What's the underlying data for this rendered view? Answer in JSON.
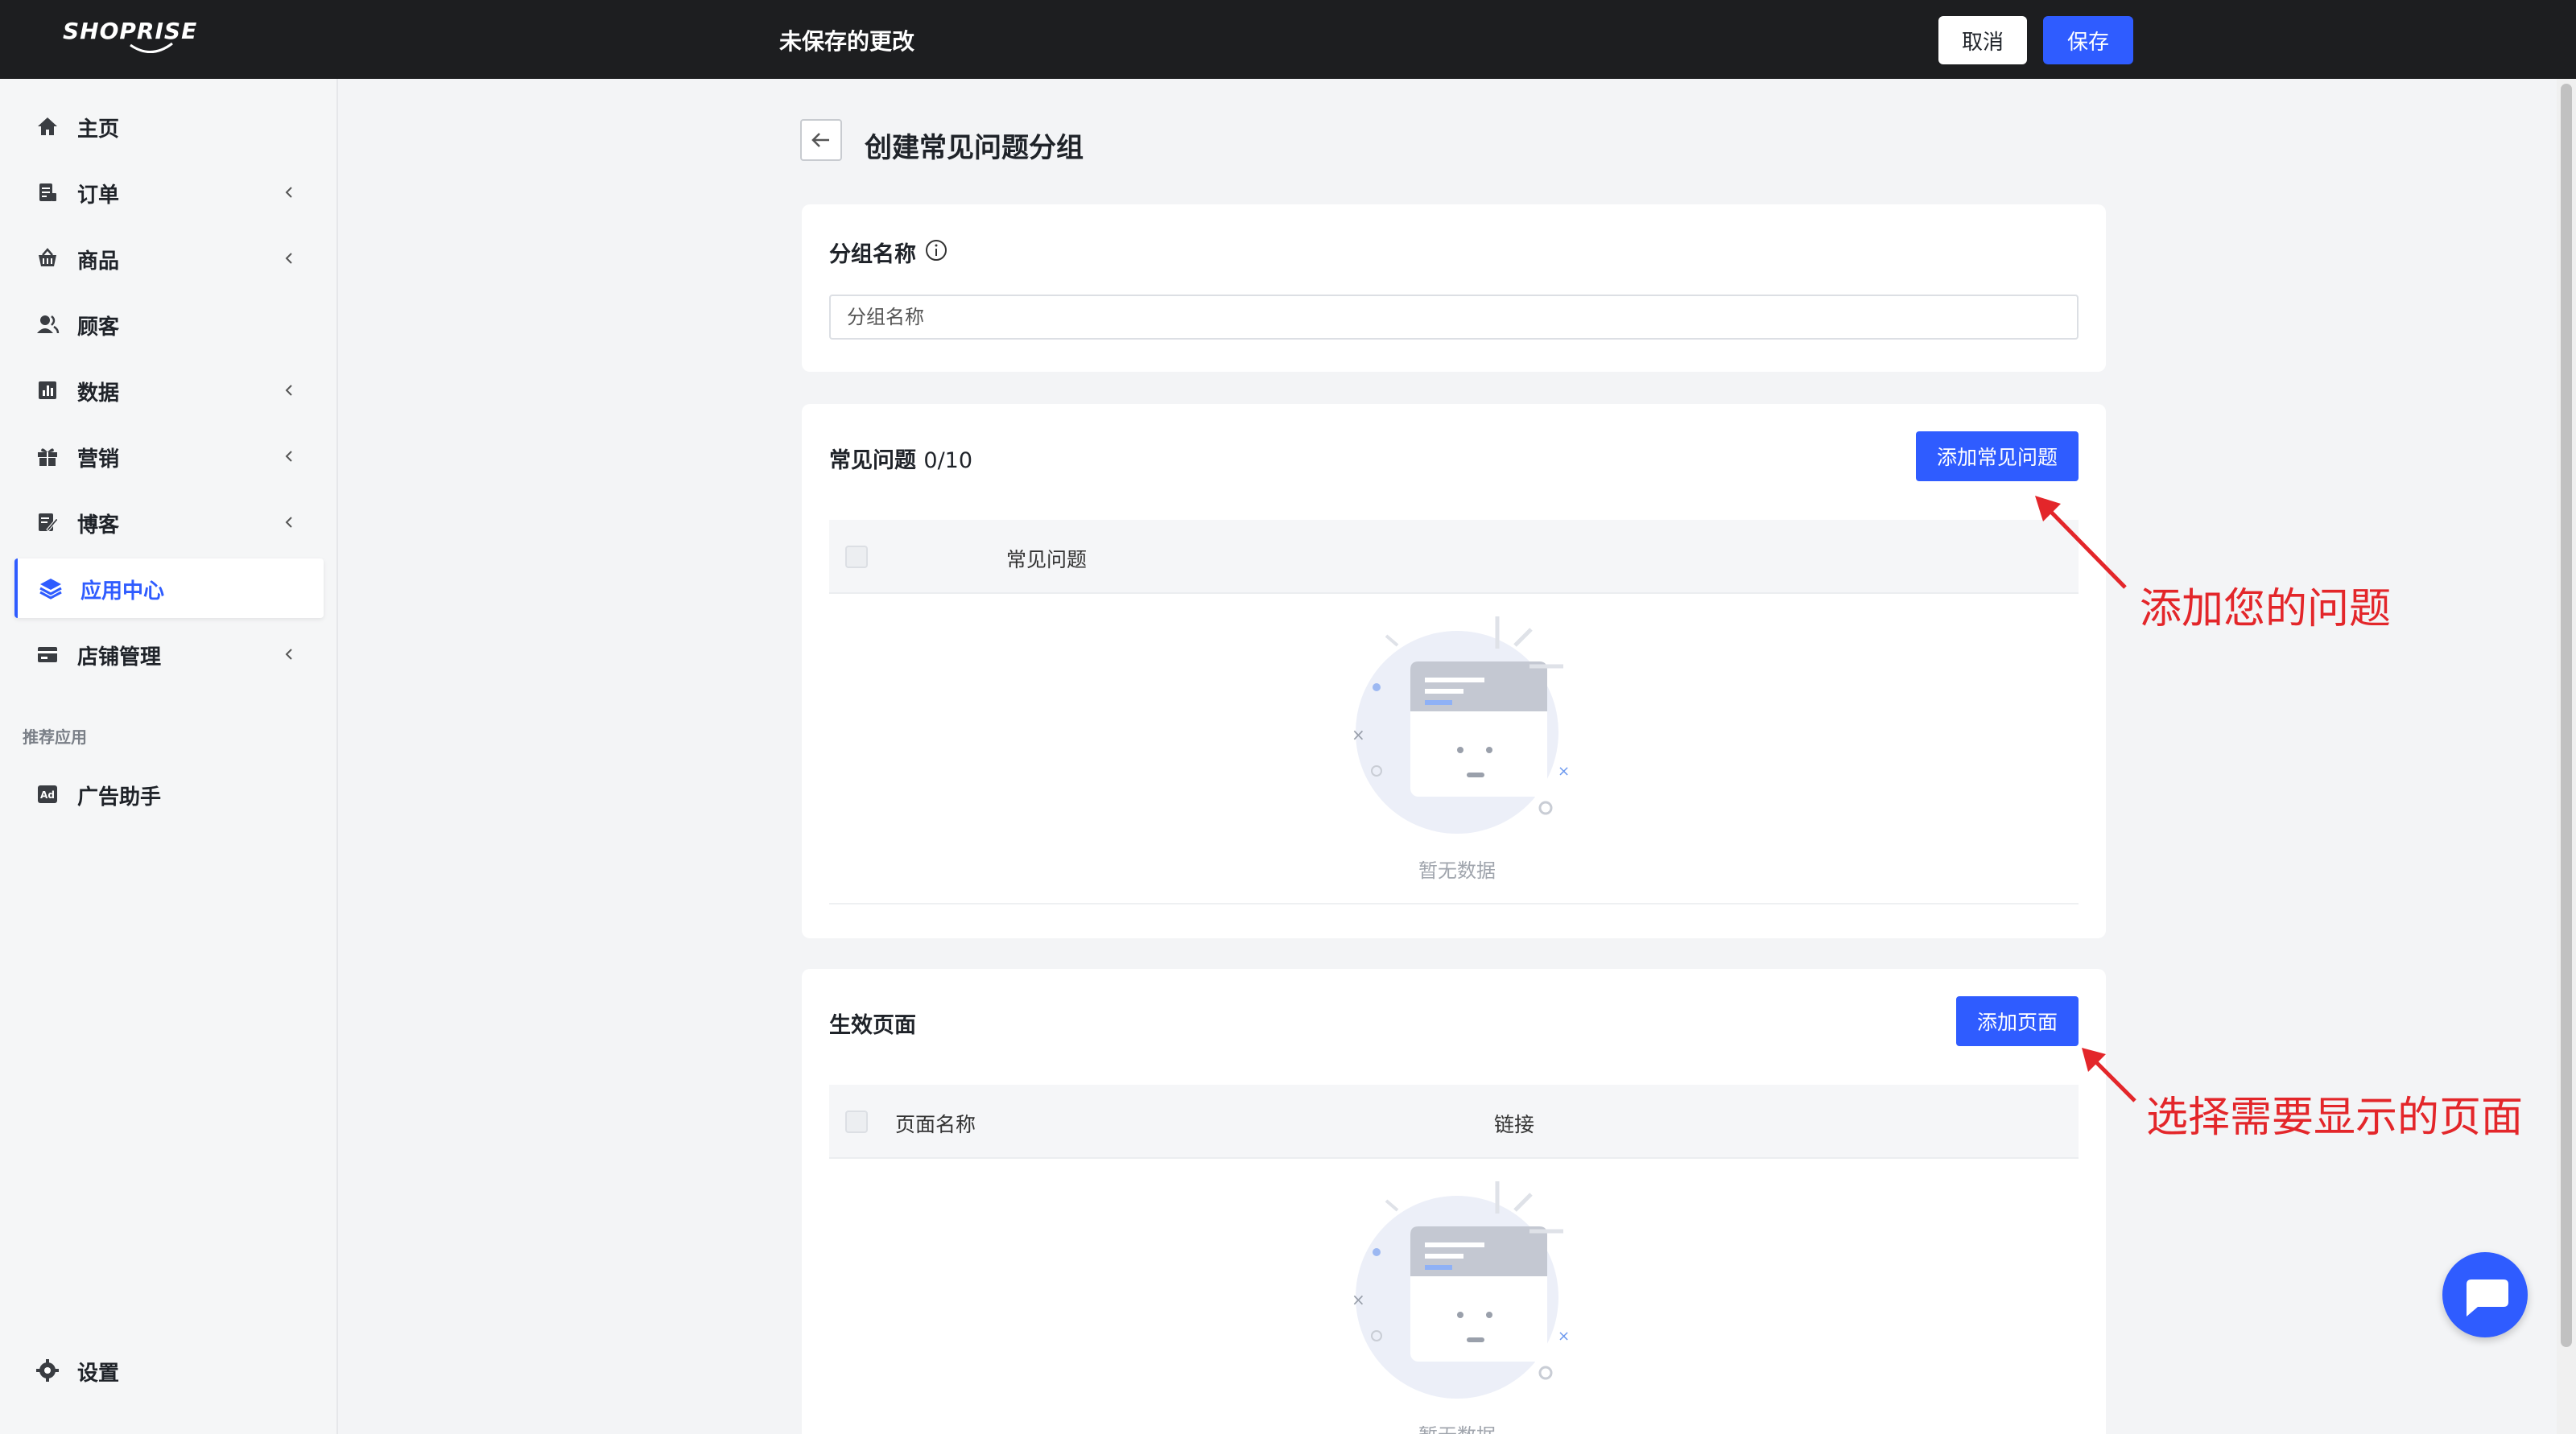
{
  "app": {
    "logo": "SHOPRISE",
    "unsaved_label": "未保存的更改",
    "cancel_label": "取消",
    "save_label": "保存"
  },
  "sidebar": {
    "items": [
      {
        "label": "主页",
        "icon": "home-icon",
        "chevron": false
      },
      {
        "label": "订单",
        "icon": "order-icon",
        "chevron": true
      },
      {
        "label": "商品",
        "icon": "basket-icon",
        "chevron": true
      },
      {
        "label": "顾客",
        "icon": "customer-icon",
        "chevron": false
      },
      {
        "label": "数据",
        "icon": "chart-icon",
        "chevron": true
      },
      {
        "label": "营销",
        "icon": "gift-icon",
        "chevron": true
      },
      {
        "label": "博客",
        "icon": "blog-icon",
        "chevron": true
      },
      {
        "label": "应用中心",
        "icon": "layers-icon",
        "chevron": false,
        "active": true
      },
      {
        "label": "店铺管理",
        "icon": "store-icon",
        "chevron": true
      }
    ],
    "recommended_label": "推荐应用",
    "recommended": [
      {
        "label": "广告助手",
        "icon": "ad-icon"
      }
    ],
    "settings_label": "设置"
  },
  "page": {
    "title": "创建常见问题分组",
    "group_name": {
      "label": "分组名称",
      "placeholder": "分组名称",
      "value": ""
    },
    "faq": {
      "label": "常见问题",
      "count": "0/10",
      "add_button": "添加常见问题",
      "columns": [
        "常见问题"
      ],
      "empty_text": "暂无数据"
    },
    "pages": {
      "label": "生效页面",
      "add_button": "添加页面",
      "columns": [
        "页面名称",
        "链接"
      ],
      "empty_text": "暂无数据"
    }
  },
  "annotations": {
    "add_question": "添加您的问题",
    "select_pages": "选择需要显示的页面"
  },
  "colors": {
    "accent": "#2f5cff",
    "topbar": "#1d1e20",
    "annotation": "#e3262a"
  }
}
